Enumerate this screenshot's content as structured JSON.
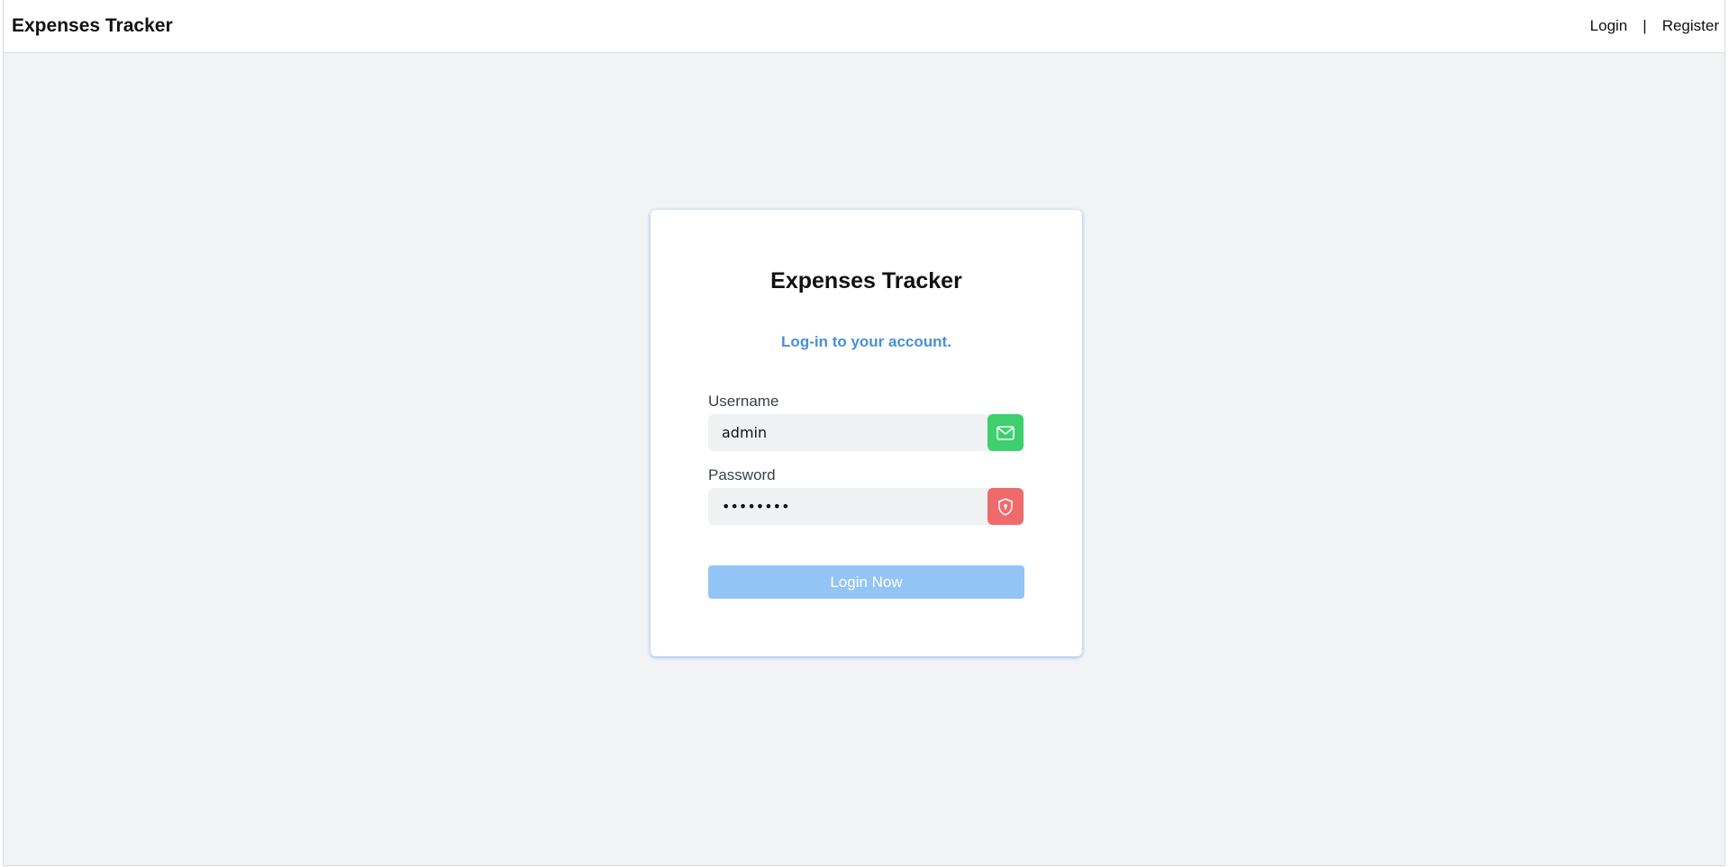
{
  "navbar": {
    "brand": "Expenses Tracker",
    "login_link": "Login",
    "separator": "|",
    "register_link": "Register"
  },
  "login_card": {
    "title": "Expenses Tracker",
    "subtitle": "Log-in to your account.",
    "username": {
      "label": "Username",
      "value": "admin",
      "icon": "mail-icon",
      "icon_color": "#3ecf6e"
    },
    "password": {
      "label": "Password",
      "value": "password",
      "icon": "shield-lock-icon",
      "icon_color": "#ef6b6b"
    },
    "submit_label": "Login Now",
    "submit_color": "#93c4f6",
    "accent_color": "#4a90d6"
  }
}
